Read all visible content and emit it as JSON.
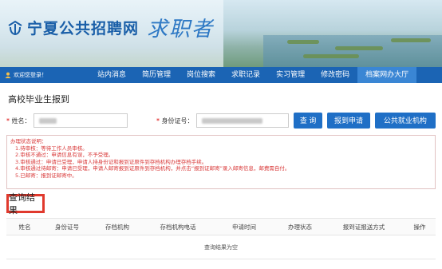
{
  "header": {
    "site_title": "宁夏公共招聘网",
    "site_subtitle": "求职者",
    "logo_icon": "grad-cap-logo-icon"
  },
  "nav": {
    "welcome": "欢迎您登录！",
    "items": [
      {
        "label": "站内消息"
      },
      {
        "label": "简历管理"
      },
      {
        "label": "岗位搜索"
      },
      {
        "label": "求职记录"
      },
      {
        "label": "实习管理"
      },
      {
        "label": "修改密码"
      },
      {
        "label": "档案网办大厅"
      }
    ],
    "active_index": 6,
    "bar_color": "#1b64b4",
    "active_color": "#3a86d4"
  },
  "page": {
    "title": "高校毕业生报到"
  },
  "form": {
    "name_label": "姓名：",
    "name_value": "",
    "id_label": "身份证号：",
    "id_value": "",
    "query_button": "查 询",
    "apply_button": "报到申请",
    "agency_button": "公共就业机构",
    "button_color": "#1f6fc6"
  },
  "notice": {
    "title": "办理状态说明：",
    "lines": [
      "1.待审核：等待工作人员审核。",
      "2.审核不通过：申请信息有误，不予受理。",
      "3.审核通过：申请已受理，申请人持身份证和报到证原件到存档机构办理存档手续。",
      "4.审核通过待邮寄：申请已受理，申请人邮寄报到证原件到存档机构，并点击“报到证邮寄”录入邮寄信息，邮费需自付。",
      "5.已邮寄：报到证邮寄中。"
    ],
    "color": "#d93a3a"
  },
  "results": {
    "title": "查询结果",
    "columns": [
      "姓名",
      "身份证号",
      "存档机构",
      "存档机构电话",
      "申请时间",
      "办理状态",
      "报到证报送方式",
      "操作"
    ],
    "empty_text": "查询结果为空",
    "highlight_color": "#e0392d"
  }
}
